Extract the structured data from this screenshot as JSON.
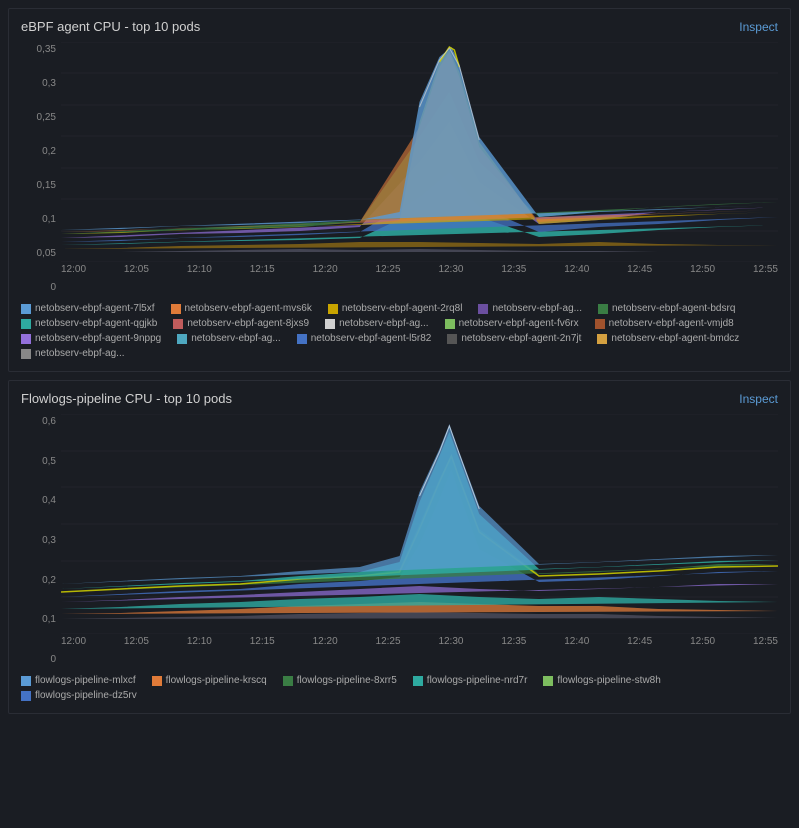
{
  "panel1": {
    "title": "eBPF agent CPU - top 10 pods",
    "inspect_label": "Inspect",
    "yAxis": [
      "0,35",
      "0,3",
      "0,25",
      "0,2",
      "0,15",
      "0,1",
      "0,05",
      "0"
    ],
    "xAxis": [
      "12:00",
      "12:05",
      "12:10",
      "12:15",
      "12:20",
      "12:25",
      "12:30",
      "12:35",
      "12:40",
      "12:45",
      "12:50",
      "12:55"
    ],
    "legend": [
      {
        "color": "#5b9bd5",
        "label": "netobserv-ebpf-agent-7l5xf"
      },
      {
        "color": "#e07b39",
        "label": "netobserv-ebpf-agent-mvs6k"
      },
      {
        "color": "#c8a400",
        "label": "netobserv-ebpf-agent-2rq8l"
      },
      {
        "color": "#6b4fa0",
        "label": "netobserv-ebpf-ag..."
      },
      {
        "color": "#3a7d44",
        "label": "netobserv-ebpf-agent-bdsrq"
      },
      {
        "color": "#2eaaa0",
        "label": "netobserv-ebpf-agent-qgjkb"
      },
      {
        "color": "#c05c5c",
        "label": "netobserv-ebpf-agent-8jxs9"
      },
      {
        "color": "#d0d0d0",
        "label": "netobserv-ebpf-ag..."
      },
      {
        "color": "#7dbd5f",
        "label": "netobserv-ebpf-agent-fv6rx"
      },
      {
        "color": "#a0522d",
        "label": "netobserv-ebpf-agent-vmjd8"
      },
      {
        "color": "#9370db",
        "label": "netobserv-ebpf-agent-9nppg"
      },
      {
        "color": "#4ea8c0",
        "label": "netobserv-ebpf-ag..."
      },
      {
        "color": "#4472c4",
        "label": "netobserv-ebpf-agent-l5r82"
      },
      {
        "color": "#555555",
        "label": "netobserv-ebpf-agent-2n7jt"
      },
      {
        "color": "#d4a040",
        "label": "netobserv-ebpf-agent-bmdcz"
      },
      {
        "color": "#888888",
        "label": "netobserv-ebpf-ag..."
      }
    ]
  },
  "panel2": {
    "title": "Flowlogs-pipeline CPU - top 10 pods",
    "inspect_label": "Inspect",
    "yAxis": [
      "0,6",
      "0,5",
      "0,4",
      "0,3",
      "0,2",
      "0,1",
      "0"
    ],
    "xAxis": [
      "12:00",
      "12:05",
      "12:10",
      "12:15",
      "12:20",
      "12:25",
      "12:30",
      "12:35",
      "12:40",
      "12:45",
      "12:50",
      "12:55"
    ],
    "legend": [
      {
        "color": "#5b9bd5",
        "label": "flowlogs-pipeline-mlxcf"
      },
      {
        "color": "#e07b39",
        "label": "flowlogs-pipeline-krscq"
      },
      {
        "color": "#3a7d44",
        "label": "flowlogs-pipeline-8xrr5"
      },
      {
        "color": "#2eaaa0",
        "label": "flowlogs-pipeline-nrd7r"
      },
      {
        "color": "#7dbd5f",
        "label": "flowlogs-pipeline-stw8h"
      },
      {
        "color": "#4472c4",
        "label": "flowlogs-pipeline-dz5rv"
      }
    ]
  }
}
